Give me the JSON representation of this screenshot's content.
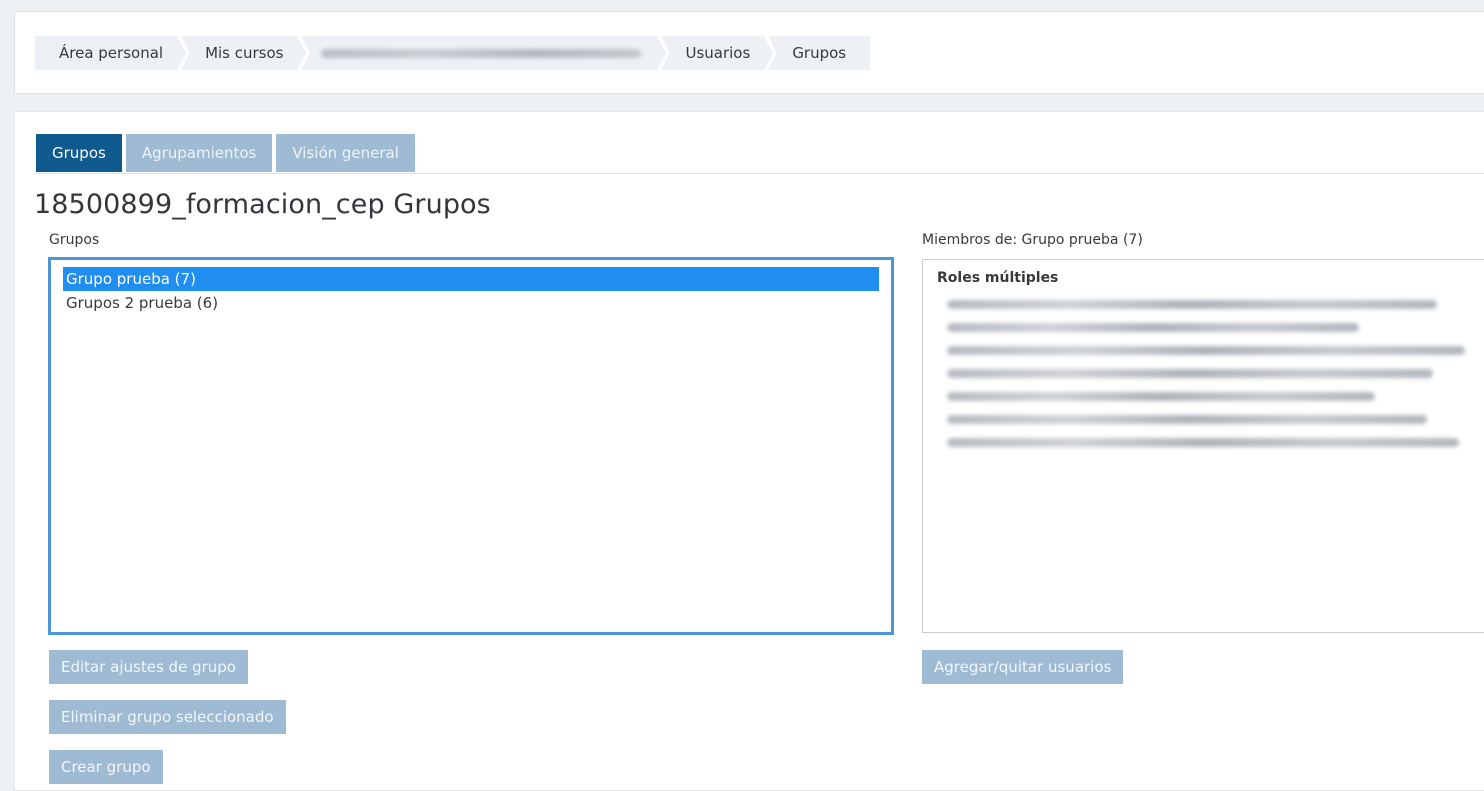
{
  "breadcrumb": {
    "items": [
      {
        "label": "Área personal"
      },
      {
        "label": "Mis cursos"
      },
      {
        "label": ""
      },
      {
        "label": "Usuarios"
      },
      {
        "label": "Grupos"
      }
    ]
  },
  "tabs": [
    {
      "label": "Grupos",
      "active": true
    },
    {
      "label": "Agrupamientos",
      "active": false
    },
    {
      "label": "Visión general",
      "active": false
    }
  ],
  "page": {
    "title": "18500899_formacion_cep Grupos"
  },
  "groups": {
    "label": "Grupos",
    "options": [
      {
        "label": "Grupo prueba (7)",
        "selected": true
      },
      {
        "label": "Grupos 2 prueba (6)",
        "selected": false
      }
    ],
    "buttons": {
      "edit": "Editar ajustes de grupo",
      "delete": "Eliminar grupo seleccionado",
      "create": "Crear grupo"
    }
  },
  "members": {
    "label": "Miembros de: Grupo prueba (7)",
    "role_heading": "Roles múltiples",
    "add_remove_button": "Agregar/quitar usuarios"
  },
  "colors": {
    "tab_active": "#0f5a8f",
    "tab_inactive": "#9fbbd3",
    "selected_option": "#1f8ef0",
    "focus_border": "#4b95d8"
  }
}
